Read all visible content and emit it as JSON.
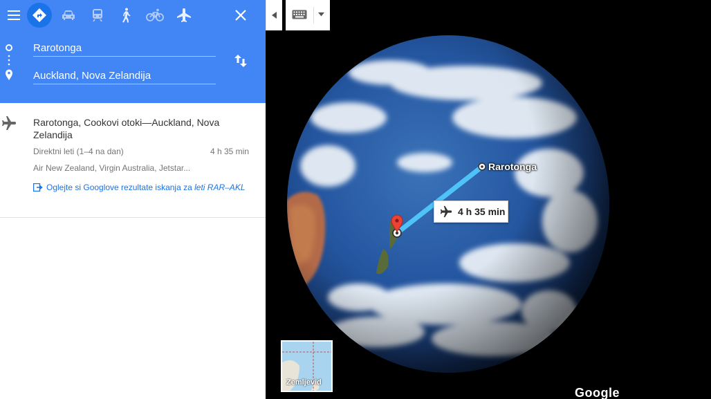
{
  "header": {
    "menu_icon": "hamburger-menu-icon",
    "modes": [
      {
        "name": "directions",
        "icon": "directions-diamond-icon",
        "active": true
      },
      {
        "name": "car",
        "icon": "car-icon"
      },
      {
        "name": "transit",
        "icon": "train-icon"
      },
      {
        "name": "walk",
        "icon": "walking-icon"
      },
      {
        "name": "bike",
        "icon": "bicycle-icon"
      },
      {
        "name": "flight",
        "icon": "airplane-icon"
      }
    ],
    "close_icon": "close-icon",
    "start_value": "Rarotonga",
    "end_value": "Auckland, Nova Zelandija",
    "swap_icon": "swap-arrows-icon"
  },
  "result": {
    "title": "Rarotonga, Cookovi otoki—Auckland, Nova Zelandija",
    "subtitle": "Direktni leti (1–4 na dan)",
    "duration": "4 h 35 min",
    "airlines": "Air New Zealand, Virgin Australia, Jetstar...",
    "link_text": "Oglejte si Googlove rezultate iskanja za ",
    "link_italic": "leti RAR–AKL"
  },
  "map": {
    "origin_label": "Rarotonga",
    "flight_duration": "4 h 35 min",
    "layer_label": "Zemljevid",
    "logo": "Google"
  },
  "colors": {
    "header_blue": "#4285f4",
    "active_mode": "#1a73e8",
    "route_line": "#4fc3f7",
    "pin_red": "#ea4335"
  }
}
